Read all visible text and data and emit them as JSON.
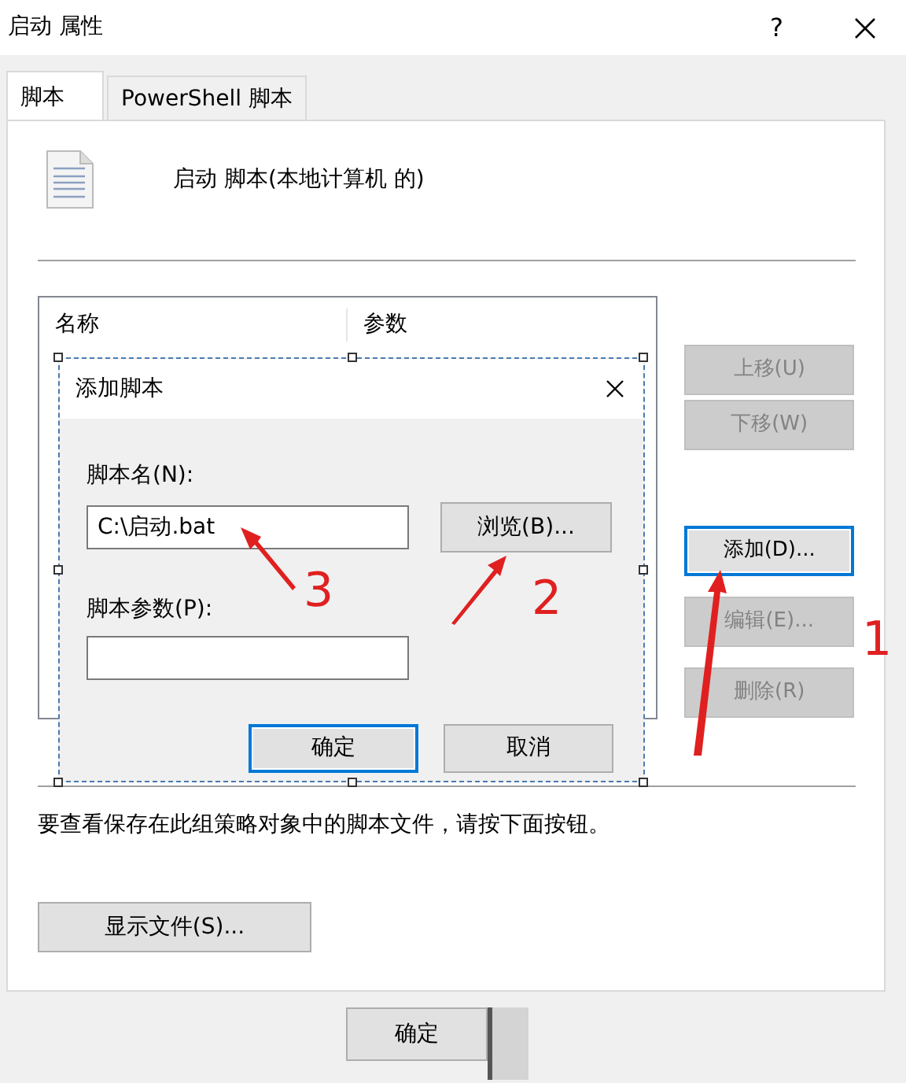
{
  "window": {
    "title": "启动 属性",
    "help_button": "?"
  },
  "tabs": [
    {
      "label": "脚本",
      "selected": true
    },
    {
      "label": "PowerShell 脚本",
      "selected": false
    }
  ],
  "header": {
    "text": "启动 脚本(本地计算机 的)"
  },
  "script_list": {
    "columns": [
      "名称",
      "参数"
    ]
  },
  "side_buttons": [
    {
      "label": "上移(U)",
      "disabled": true,
      "focused": false
    },
    {
      "label": "下移(W)",
      "disabled": true,
      "focused": false
    },
    {
      "label": "添加(D)...",
      "disabled": false,
      "focused": true
    },
    {
      "label": "编辑(E)...",
      "disabled": true,
      "focused": false
    },
    {
      "label": "删除(R)",
      "disabled": true,
      "focused": false
    }
  ],
  "note": "要查看保存在此组策略对象中的脚本文件，请按下面按钮。",
  "show_files_button": "显示文件(S)...",
  "footer_buttons": [
    {
      "label": "确定"
    }
  ],
  "add_dialog": {
    "title": "添加脚本",
    "fields": [
      {
        "label": "脚本名(N):",
        "value": "C:\\启动.bat"
      },
      {
        "label": "脚本参数(P):"
      }
    ],
    "browse_button": "浏览(B)...",
    "buttons": [
      {
        "label": "确定",
        "default": true
      },
      {
        "label": "取消",
        "default": false
      }
    ]
  },
  "annotations": [
    {
      "label": "1"
    },
    {
      "label": "2"
    },
    {
      "label": "3"
    }
  ]
}
